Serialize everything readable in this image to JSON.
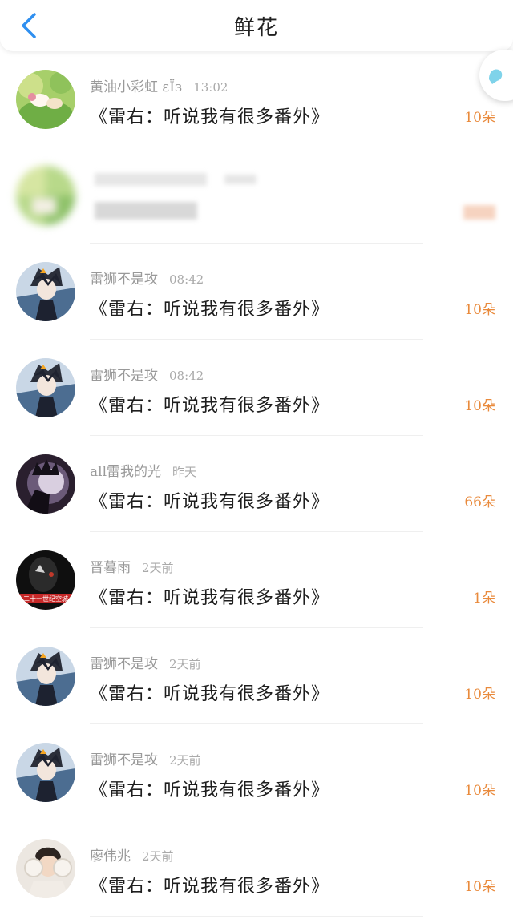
{
  "header": {
    "title": "鲜花"
  },
  "book_title": "《雷右：听说我有很多番外》",
  "rows": [
    {
      "user": "黄油小彩虹 εÏз",
      "time": "13:02",
      "count": "10朵",
      "avatar": "rainbow-green"
    },
    {
      "user": "",
      "time": "",
      "count": "",
      "avatar": "blurred-green"
    },
    {
      "user": "雷狮不是攻",
      "time": "08:42",
      "count": "10朵",
      "avatar": "anime-boy"
    },
    {
      "user": "雷狮不是攻",
      "time": "08:42",
      "count": "10朵",
      "avatar": "anime-boy"
    },
    {
      "user": "all雷我的光",
      "time": "昨天",
      "count": "66朵",
      "avatar": "dark-crown"
    },
    {
      "user": "晋暮雨",
      "time": "2天前",
      "count": "1朵",
      "avatar": "black-mask"
    },
    {
      "user": "雷狮不是攻",
      "time": "2天前",
      "count": "10朵",
      "avatar": "anime-boy"
    },
    {
      "user": "雷狮不是攻",
      "time": "2天前",
      "count": "10朵",
      "avatar": "anime-boy"
    },
    {
      "user": "廖伟兆",
      "time": "2天前",
      "count": "10朵",
      "avatar": "earmuff-girl"
    }
  ],
  "avatar_texts": {
    "black_mask_banner": "二十一世纪空城"
  },
  "colors": {
    "accent": "#2f8ff0",
    "flower_count": "#e98a3c",
    "meta": "#999999"
  }
}
